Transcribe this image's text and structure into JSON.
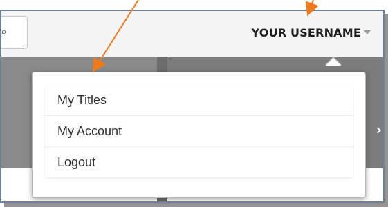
{
  "header": {
    "username": "YOUR USERNAME"
  },
  "menu": {
    "items": [
      {
        "label": "My Titles"
      },
      {
        "label": "My Account"
      },
      {
        "label": "Logout"
      }
    ]
  },
  "icons": {
    "search": "search-icon",
    "caret": "chevron-down-icon",
    "next": "chevron-right-icon"
  },
  "colors": {
    "annotation_arrow": "#f07a1a",
    "frame_border": "#6f7f95"
  }
}
